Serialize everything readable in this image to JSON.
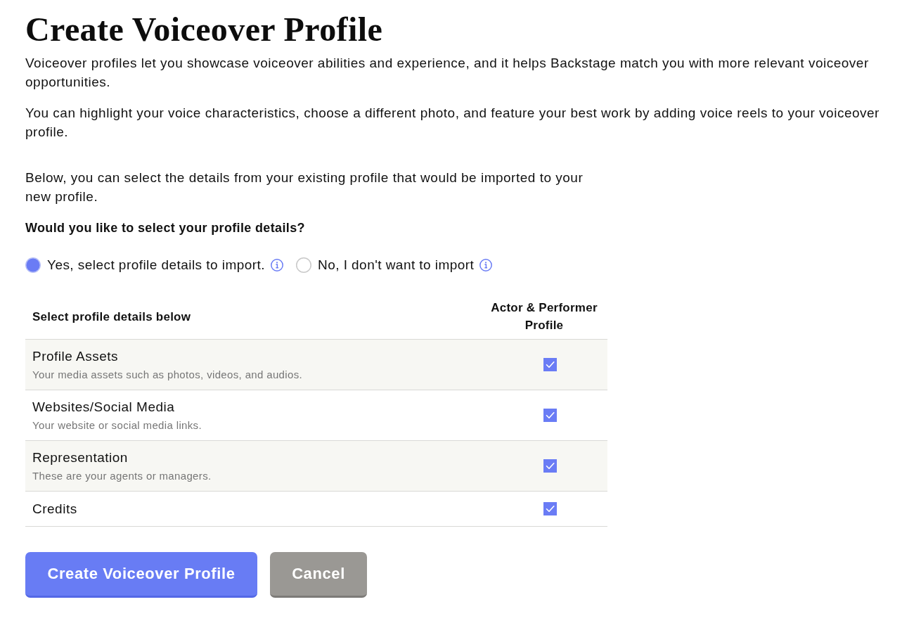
{
  "page": {
    "title": "Create Voiceover Profile",
    "intro": [
      "Voiceover profiles let you showcase voiceover abilities and experience, and it helps Backstage match you with more relevant voiceover opportunities.",
      "You can highlight your voice characteristics, choose a different photo, and feature your best work by adding voice reels to your voiceover profile."
    ],
    "import_note": "Below, you can select the details from your existing profile that would be imported to your new profile.",
    "question": "Would you like to select your profile details?"
  },
  "import_options": [
    {
      "label": "Yes, select profile details to import.",
      "selected": true
    },
    {
      "label": "No, I don't want to import",
      "selected": false
    }
  ],
  "details_table": {
    "columns": [
      "Select profile details below",
      "Actor & Performer Profile"
    ],
    "rows": [
      {
        "title": "Profile Assets",
        "description": "Your media assets such as photos, videos, and audios.",
        "checked": true
      },
      {
        "title": "Websites/Social Media",
        "description": "Your website or social media links.",
        "checked": true
      },
      {
        "title": "Representation",
        "description": "These are your agents or managers.",
        "checked": true
      },
      {
        "title": "Credits",
        "checked": true
      }
    ]
  },
  "buttons": [
    {
      "label": "Create Voiceover Profile",
      "kind": "primary"
    },
    {
      "label": "Cancel",
      "kind": "secondary"
    }
  ]
}
